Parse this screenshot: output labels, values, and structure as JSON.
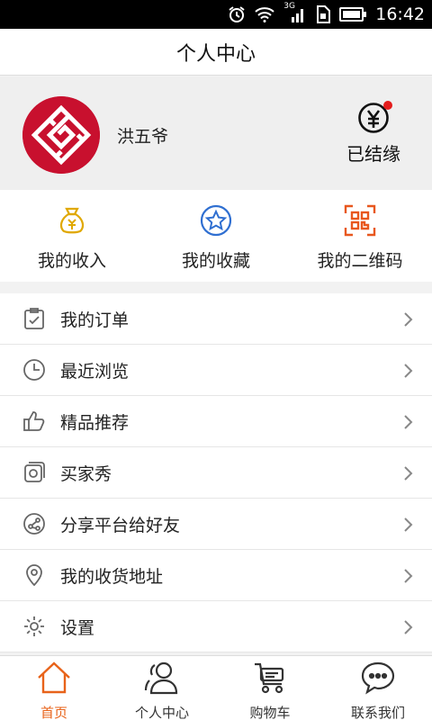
{
  "status_bar": {
    "time": "16:42",
    "network": "3G"
  },
  "header": {
    "title": "个人中心"
  },
  "profile": {
    "username": "洪五爷",
    "binding_label": "已结缘"
  },
  "quick_actions": [
    {
      "label": "我的收入",
      "icon": "money-bag-icon"
    },
    {
      "label": "我的收藏",
      "icon": "star-icon"
    },
    {
      "label": "我的二维码",
      "icon": "qr-code-icon"
    }
  ],
  "menu": [
    {
      "label": "我的订单",
      "icon": "order-icon"
    },
    {
      "label": "最近浏览",
      "icon": "clock-icon"
    },
    {
      "label": "精品推荐",
      "icon": "thumbs-up-icon"
    },
    {
      "label": "买家秀",
      "icon": "photo-icon"
    },
    {
      "label": "分享平台给好友",
      "icon": "share-icon"
    },
    {
      "label": "我的收货地址",
      "icon": "location-icon"
    },
    {
      "label": "设置",
      "icon": "gear-icon"
    }
  ],
  "tabs": [
    {
      "label": "首页",
      "icon": "home-icon",
      "active": true
    },
    {
      "label": "个人中心",
      "icon": "user-icon",
      "active": false
    },
    {
      "label": "购物车",
      "icon": "cart-icon",
      "active": false
    },
    {
      "label": "联系我们",
      "icon": "chat-icon",
      "active": false
    }
  ],
  "colors": {
    "accent": "#e8631a",
    "gold": "#e0a800",
    "blue": "#2f6fd1",
    "qr_orange": "#e8571e",
    "badge_red": "#e41c1c",
    "avatar_red": "#c8102e"
  }
}
